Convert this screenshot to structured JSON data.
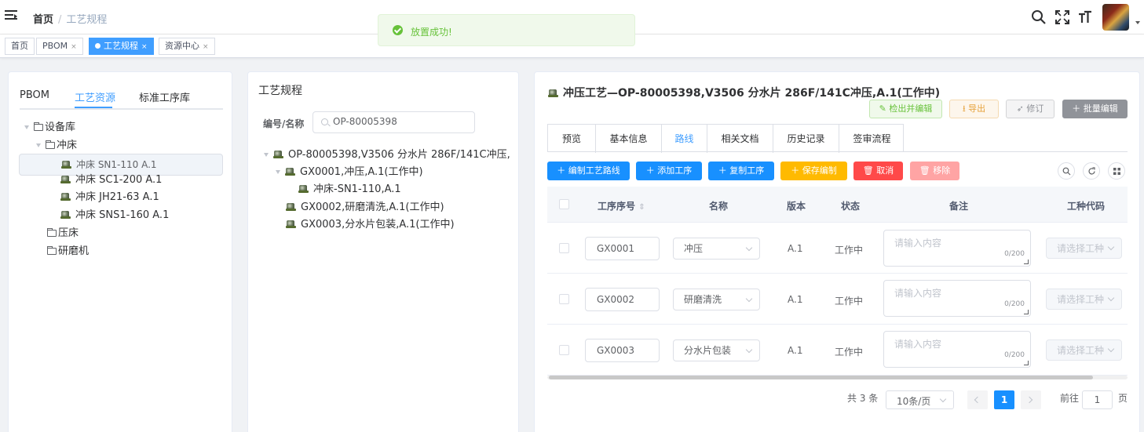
{
  "navbar": {
    "breadcrumb_home": "首页",
    "breadcrumb_sep": "/",
    "breadcrumb_current": "工艺规程"
  },
  "tags": [
    {
      "label": "首页",
      "closable": false,
      "active": false
    },
    {
      "label": "PBOM",
      "closable": true,
      "active": false
    },
    {
      "label": "工艺规程",
      "closable": true,
      "active": true
    },
    {
      "label": "资源中心",
      "closable": true,
      "active": false
    }
  ],
  "tag_close_glyph": "×",
  "toast": {
    "message": "放置成功!"
  },
  "left_panel": {
    "tabs": [
      "PBOM",
      "工艺资源",
      "标准工序库"
    ],
    "active_tab": "工艺资源",
    "tree": {
      "root": "设备库",
      "folders": [
        "冲床",
        "压床",
        "研磨机"
      ],
      "machines": [
        "冲床 SN1-110 A.1",
        "冲床 SC1-200 A.1",
        "冲床 JH21-63 A.1",
        "冲床 SNS1-160 A.1"
      ]
    }
  },
  "middle_panel": {
    "title": "工艺规程",
    "search_label": "编号/名称",
    "search_value": "OP-80005398",
    "tree": {
      "root": "OP-80005398,V3506 分水片 286F/141C冲压,",
      "children": [
        {
          "label": "GX0001,冲压,A.1(工作中)",
          "child": "冲床-SN1-110,A.1"
        },
        {
          "label": "GX0002,研磨清洗,A.1(工作中)"
        },
        {
          "label": "GX0003,分水片包装,A.1(工作中)"
        }
      ]
    }
  },
  "right_panel": {
    "title": "冲压工艺—OP-80005398,V3506 分水片 286F/141C冲压,A.1(工作中)",
    "toolbar": {
      "checkout": "检出并编辑",
      "export": "导出",
      "revise": "修订",
      "batch_edit": "批量编辑"
    },
    "tabs": [
      "预览",
      "基本信息",
      "路线",
      "相关文档",
      "历史记录",
      "签审流程"
    ],
    "active_tab": "路线",
    "actions": {
      "edit_route": "编制工艺路线",
      "add_process": "添加工序",
      "copy_process": "复制工序",
      "save": "保存编制",
      "cancel": "取消",
      "remove": "移除"
    },
    "columns": [
      "工序序号",
      "名称",
      "版本",
      "状态",
      "备注",
      "工种代码"
    ],
    "rows": [
      {
        "seq": "GX0001",
        "name": "冲压",
        "version": "A.1",
        "status": "工作中",
        "note_placeholder": "请输入内容",
        "note_count": "0/200",
        "work_type_placeholder": "请选择工种"
      },
      {
        "seq": "GX0002",
        "name": "研磨清洗",
        "version": "A.1",
        "status": "工作中",
        "note_placeholder": "请输入内容",
        "note_count": "0/200",
        "work_type_placeholder": "请选择工种"
      },
      {
        "seq": "GX0003",
        "name": "分水片包装",
        "version": "A.1",
        "status": "工作中",
        "note_placeholder": "请输入内容",
        "note_count": "0/200",
        "work_type_placeholder": "请选择工种"
      }
    ],
    "pagination": {
      "total": "共 3 条",
      "page_size": "10条/页",
      "current_page": "1",
      "goto_label": "前往",
      "goto_value": "1",
      "page_unit": "页"
    }
  },
  "colors": {
    "primary": "#1890ff",
    "active_tag": "#409eff",
    "success": "#67c23a",
    "warning": "#ffba00",
    "danger": "#ff4949"
  }
}
